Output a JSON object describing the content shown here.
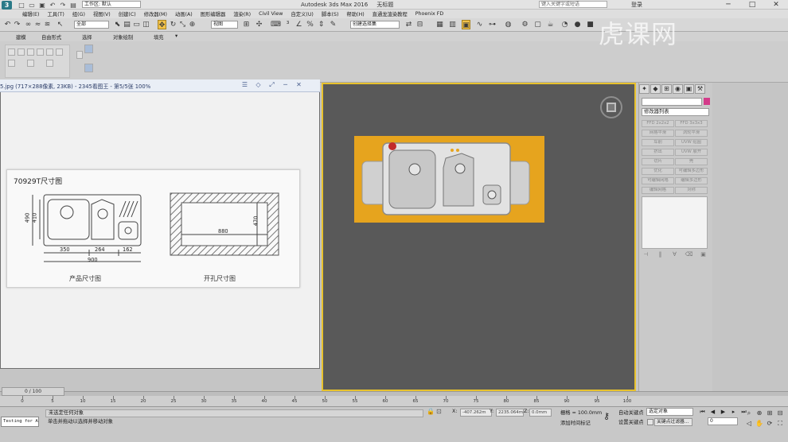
{
  "title_bar": {
    "app_title": "Autodesk 3ds Max 2016",
    "document": "无标题",
    "workspace": "工作区: 默认",
    "search_placeholder": "键入关键字或短语",
    "login": "登录"
  },
  "menu": [
    "编辑(E)",
    "工具(T)",
    "组(G)",
    "视图(V)",
    "创建(C)",
    "修改器(M)",
    "动画(A)",
    "图形编辑器",
    "渲染(R)",
    "Civil View",
    "自定义(U)",
    "脚本(S)",
    "帮助(H)",
    "直通龙渲染教程",
    "Phoenix FD"
  ],
  "toolbar": {
    "selection_filter": "全部",
    "ref_coord": "视图",
    "named_selection": "创建选择集"
  },
  "ribbon_tabs": [
    "建模",
    "自由形式",
    "选择",
    "对象绘制",
    "填充"
  ],
  "image_viewer": {
    "title": "5.jpg (717×288像素, 23KB) - 2345看图王 - 第5/5张 100%",
    "spec_title": "70929T尺寸图",
    "product_caption": "产品尺寸图",
    "cutout_caption": "开孔尺寸图",
    "dims": {
      "height_outer": "490",
      "height_inner": "410",
      "w1": "350",
      "w2": "264",
      "w3": "162",
      "total": "900",
      "cut_w": "880",
      "cut_h": "470"
    }
  },
  "command_panel": {
    "modifier_list": "修改器列表",
    "buttons": [
      "FFD 2x2x2",
      "FFD 3x3x3",
      "网格平滑",
      "涡轮平滑",
      "车削",
      "UVW 贴图",
      "挤出",
      "UVW 展开",
      "切片",
      "壳",
      "优化",
      "可编辑多边形",
      "可编辑网格",
      "编辑多边形",
      "编辑网格",
      "对称"
    ],
    "accent_color": "#d43b8a"
  },
  "timeline": {
    "position": "0 / 100",
    "ticks": [
      "0",
      "5",
      "10",
      "15",
      "20",
      "25",
      "30",
      "35",
      "40",
      "45",
      "50",
      "55",
      "60",
      "65",
      "70",
      "75",
      "80",
      "85",
      "90",
      "95",
      "100"
    ]
  },
  "status": {
    "listener": "Testing for ALL",
    "line1": "未选定任何对象",
    "line2": "单击并拖动以选择并移动对象",
    "x_label": "X:",
    "x_value": "-407.262m",
    "y_label": "Y:",
    "y_value": "2235.064m",
    "z_label": "Z:",
    "z_value": "0.0mm",
    "grid": "栅格 = 100.0mm",
    "time_tag": "添加时间标记",
    "auto_key": "自动关键点",
    "set_key": "设置关键点",
    "selected_object": "选定对象",
    "key_filter": "关键点过滤器...",
    "frame": "0"
  },
  "watermark": "虎课网",
  "viewport_frame_color": "#e8c22d"
}
